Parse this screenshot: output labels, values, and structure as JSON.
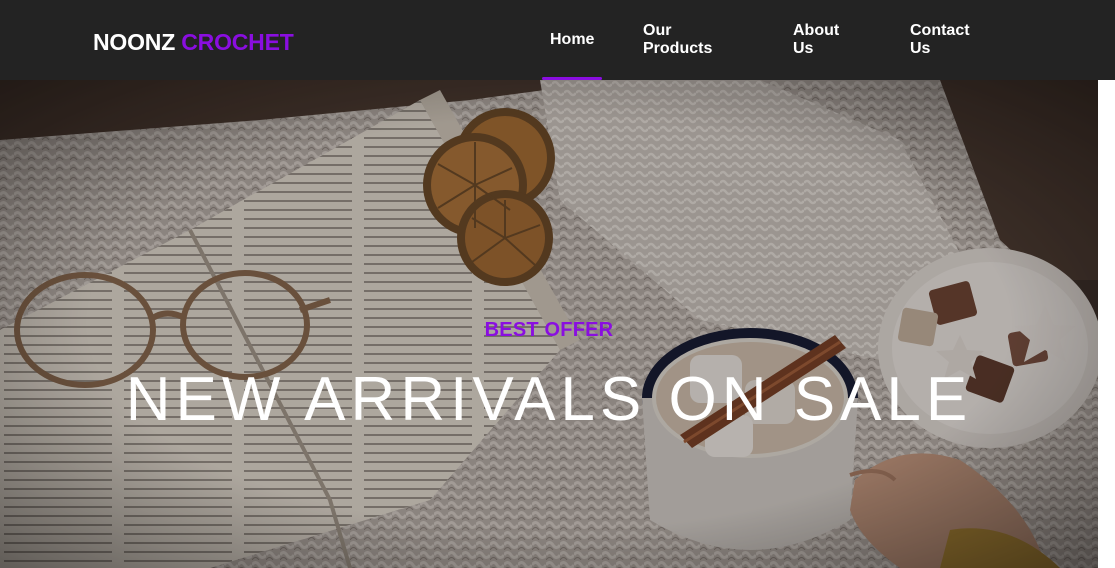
{
  "brand": {
    "part1": "NOONZ",
    "part2": "CROCHET"
  },
  "nav": {
    "items": [
      {
        "label": "Home",
        "active": true
      },
      {
        "label": "Our Products",
        "active": false
      },
      {
        "label": "About Us",
        "active": false
      },
      {
        "label": "Contact Us",
        "active": false
      }
    ]
  },
  "hero": {
    "eyebrow": "BEST OFFER",
    "headline": "NEW ARRIVALS ON SALE"
  },
  "colors": {
    "accent": "#8a0ee0",
    "navbar_bg": "#232323",
    "text_light": "#ffffff"
  }
}
